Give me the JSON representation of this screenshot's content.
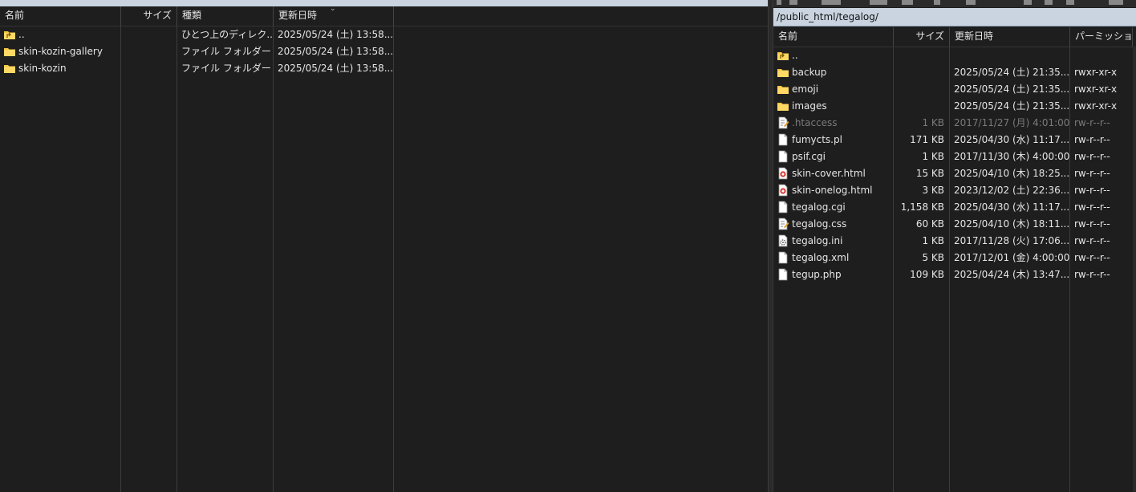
{
  "left_pane": {
    "columns": [
      "名前",
      "サイズ",
      "種類",
      "更新日時"
    ],
    "rows": [
      {
        "icon": "parent-folder-icon",
        "name": "..",
        "size": "",
        "type": "ひとつ上のディレク...",
        "modified": "2025/05/24 (土) 13:58..."
      },
      {
        "icon": "folder-icon",
        "name": "skin-kozin-gallery",
        "size": "",
        "type": "ファイル フォルダー",
        "modified": "2025/05/24 (土) 13:58..."
      },
      {
        "icon": "folder-icon",
        "name": "skin-kozin",
        "size": "",
        "type": "ファイル フォルダー",
        "modified": "2025/05/24 (土) 13:58..."
      }
    ]
  },
  "right_pane": {
    "path": "/public_html/tegalog/",
    "columns": [
      "名前",
      "サイズ",
      "更新日時",
      "パーミッション"
    ],
    "rows": [
      {
        "icon": "parent-folder-icon",
        "name": "..",
        "size": "",
        "modified": "",
        "perm": "",
        "dim": false
      },
      {
        "icon": "folder-icon",
        "name": "backup",
        "size": "",
        "modified": "2025/05/24 (土) 21:35...",
        "perm": "rwxr-xr-x",
        "dim": false
      },
      {
        "icon": "folder-icon",
        "name": "emoji",
        "size": "",
        "modified": "2025/05/24 (土) 21:35...",
        "perm": "rwxr-xr-x",
        "dim": false
      },
      {
        "icon": "folder-icon",
        "name": "images",
        "size": "",
        "modified": "2025/05/24 (土) 21:35...",
        "perm": "rwxr-xr-x",
        "dim": false
      },
      {
        "icon": "text-edit-file-icon",
        "name": ".htaccess",
        "size": "1 KB",
        "modified": "2017/11/27 (月) 4:01:00",
        "perm": "rw-r--r--",
        "dim": true
      },
      {
        "icon": "file-icon",
        "name": "fumycts.pl",
        "size": "171 KB",
        "modified": "2025/04/30 (水) 11:17...",
        "perm": "rw-r--r--",
        "dim": false
      },
      {
        "icon": "file-icon",
        "name": "psif.cgi",
        "size": "1 KB",
        "modified": "2017/11/30 (木) 4:00:00",
        "perm": "rw-r--r--",
        "dim": false
      },
      {
        "icon": "html-file-icon",
        "name": "skin-cover.html",
        "size": "15 KB",
        "modified": "2025/04/10 (木) 18:25...",
        "perm": "rw-r--r--",
        "dim": false
      },
      {
        "icon": "html-file-icon",
        "name": "skin-onelog.html",
        "size": "3 KB",
        "modified": "2023/12/02 (土) 22:36...",
        "perm": "rw-r--r--",
        "dim": false
      },
      {
        "icon": "file-icon",
        "name": "tegalog.cgi",
        "size": "1,158 KB",
        "modified": "2025/04/30 (水) 11:17...",
        "perm": "rw-r--r--",
        "dim": false
      },
      {
        "icon": "text-edit-file-icon",
        "name": "tegalog.css",
        "size": "60 KB",
        "modified": "2025/04/10 (木) 18:11...",
        "perm": "rw-r--r--",
        "dim": false
      },
      {
        "icon": "settings-file-icon",
        "name": "tegalog.ini",
        "size": "1 KB",
        "modified": "2017/11/28 (火) 17:06...",
        "perm": "rw-r--r--",
        "dim": false
      },
      {
        "icon": "file-icon",
        "name": "tegalog.xml",
        "size": "5 KB",
        "modified": "2017/12/01 (金) 4:00:00",
        "perm": "rw-r--r--",
        "dim": false
      },
      {
        "icon": "file-icon",
        "name": "tegup.php",
        "size": "109 KB",
        "modified": "2025/04/24 (木) 13:47...",
        "perm": "rw-r--r--",
        "dim": false
      }
    ]
  },
  "colors": {
    "background": "#1e1e1e",
    "text": "#e6e6e6",
    "dim_text": "#7a7a7a",
    "path_bar": "#c9d4e0",
    "folder": "#f5c542"
  }
}
